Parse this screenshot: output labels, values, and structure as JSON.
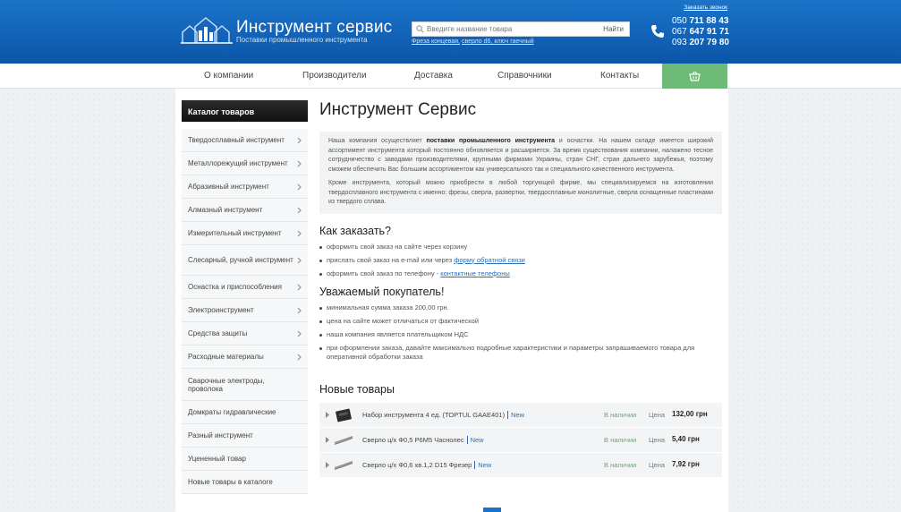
{
  "header": {
    "brand_title": "Инструмент сервис",
    "brand_subtitle": "Поставки промышленного инструмента",
    "search": {
      "placeholder": "Введите название товара",
      "button_label": "Найти",
      "hint_prefix": "Фреза концевая,",
      "hint_examples": "сверло d6, ключ гаечный"
    },
    "callback_label": "Заказать звонок",
    "phones": [
      {
        "prefix": "050",
        "number": "711 88 43"
      },
      {
        "prefix": "067",
        "number": "647 91 71"
      },
      {
        "prefix": "093",
        "number": "207 79 80"
      }
    ],
    "colors": {
      "header_top": "#1b74c9",
      "header_bottom": "#0b55a8"
    }
  },
  "nav": {
    "items": [
      "О компании",
      "Производители",
      "Доставка",
      "Справочники",
      "Контакты"
    ],
    "cart_icon": "basket-icon",
    "cart_color": "#6dbb77"
  },
  "sidebar": {
    "title": "Каталог товаров",
    "items": [
      {
        "label": "Твердосплавный инструмент",
        "has_sub": true
      },
      {
        "label": "Металлорежущий инструмент",
        "has_sub": true
      },
      {
        "label": "Абразивный инструмент",
        "has_sub": true
      },
      {
        "label": "Алмазный инструмент",
        "has_sub": true
      },
      {
        "label": "Измерительный инструмент",
        "has_sub": true
      },
      {
        "label": "Слесарный, ручной инструмент",
        "has_sub": true
      },
      {
        "label": "Оснастка и приспособления",
        "has_sub": true
      },
      {
        "label": "Электроинструмент",
        "has_sub": true
      },
      {
        "label": "Средства защиты",
        "has_sub": true
      },
      {
        "label": "Расходные материалы",
        "has_sub": true
      },
      {
        "label": "Сварочные электроды, проволока",
        "has_sub": false
      },
      {
        "label": "Домкраты гидравлические",
        "has_sub": false
      },
      {
        "label": "Разный инструмент",
        "has_sub": false
      },
      {
        "label": "Уцененный товар",
        "has_sub": false
      },
      {
        "label": "Новые товары в каталоге",
        "has_sub": false
      }
    ]
  },
  "content": {
    "title": "Инструмент Сервис",
    "intro_p1_before": "Наша компания осуществляет ",
    "intro_p1_bold": "поставки промышленного инструмента",
    "intro_p1_after": " и оснастки. На нашем складе имеется широкий ассортимент инструмента который постоянно обновляется и расширяется. За время существования компании, налажено тесное сотрудничество с заводами производителями, крупными фирмами Украины, стран СНГ, стран дальнего зарубежья, поэтому сможем обеспечить Вас большим ассортиментом как универсального так и специального качественного инструмента.",
    "intro_p2": "Кроме инструмента, который можно приобрести в любой торгующей фирме, мы специализируемся на изготовлении твердосплавного инструмента с именно: фрезы, сверла, развертки, твердосплавные монолитные, сверла оснащенные пластинами из твердого сплава.",
    "how_title": "Как заказать?",
    "how_items": {
      "i1": "оформить свой заказ на сайте через корзину",
      "i2_before": "прислать свой заказ на e-mail или через ",
      "i2_link": "форму обратной связи",
      "i3_before": "оформить свой заказ по телефону - ",
      "i3_link": "контактные телефоны"
    },
    "buyer_title": "Уважаемый покупатель!",
    "buyer_items": [
      "минимальная сумма заказа 200,00 грн.",
      "цена на сайте может отличаться от фактической",
      "наша компания является плательщиком НДС",
      "при оформлении заказа, давайте максимально подробные характеристики и параметры запрашиваемого товара для оперативной обработки заказа"
    ],
    "new_title": "Новые товары",
    "products": [
      {
        "name": "Набор инструмента 4 ед. (TOPTUL GAAE401)",
        "badge": "New",
        "stock": "В наличии",
        "price_label": "Цена",
        "price": "132,00 грн"
      },
      {
        "name": "Сверло ц/х Ф0,5 Р6М5 Часнолес",
        "badge": "New",
        "stock": "В наличии",
        "price_label": "Цена",
        "price": "5,40 грн"
      },
      {
        "name": "Сверло ц/х Ф0,6 хв.1,2 D15 Фрезер",
        "badge": "New",
        "stock": "В наличии",
        "price_label": "Цена",
        "price": "7,92 грн"
      }
    ]
  }
}
